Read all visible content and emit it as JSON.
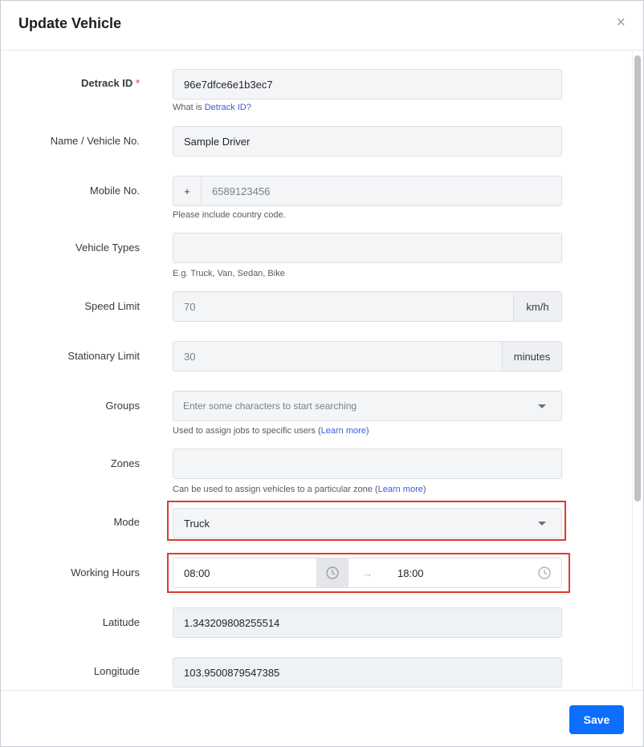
{
  "modal": {
    "title": "Update Vehicle",
    "close_label": "×"
  },
  "fields": {
    "detrack_id": {
      "label": "Detrack ID",
      "required_mark": "*",
      "value": "96e7dfce6e1b3ec7",
      "help_prefix": "What is ",
      "help_link": "Detrack ID?"
    },
    "name": {
      "label": "Name / Vehicle No.",
      "value": "Sample Driver"
    },
    "mobile": {
      "label": "Mobile No.",
      "prefix": "+",
      "placeholder": "6589123456",
      "help": "Please include country code."
    },
    "vehicle_types": {
      "label": "Vehicle Types",
      "value": "",
      "help": "E.g. Truck, Van, Sedan, Bike"
    },
    "speed_limit": {
      "label": "Speed Limit",
      "placeholder": "70",
      "unit": "km/h"
    },
    "stationary_limit": {
      "label": "Stationary Limit",
      "placeholder": "30",
      "unit": "minutes"
    },
    "groups": {
      "label": "Groups",
      "placeholder": "Enter some characters to start searching",
      "help_prefix": "Used to assign jobs to specific users (",
      "help_link": "Learn more",
      "help_suffix": ")"
    },
    "zones": {
      "label": "Zones",
      "value": "",
      "help_prefix": "Can be used to assign vehicles to a particular zone (",
      "help_link": "Learn more",
      "help_suffix": ")"
    },
    "mode": {
      "label": "Mode",
      "value": "Truck"
    },
    "working_hours": {
      "label": "Working Hours",
      "start": "08:00",
      "separator": "→",
      "end": "18:00"
    },
    "latitude": {
      "label": "Latitude",
      "value": "1.343209808255514"
    },
    "longitude": {
      "label": "Longitude",
      "value": "103.9500879547385"
    }
  },
  "footer": {
    "save_label": "Save"
  },
  "colors": {
    "primary": "#0d6efd",
    "highlight": "#e03a2f",
    "required": "#dc3545",
    "link": "#3b5bdb"
  }
}
